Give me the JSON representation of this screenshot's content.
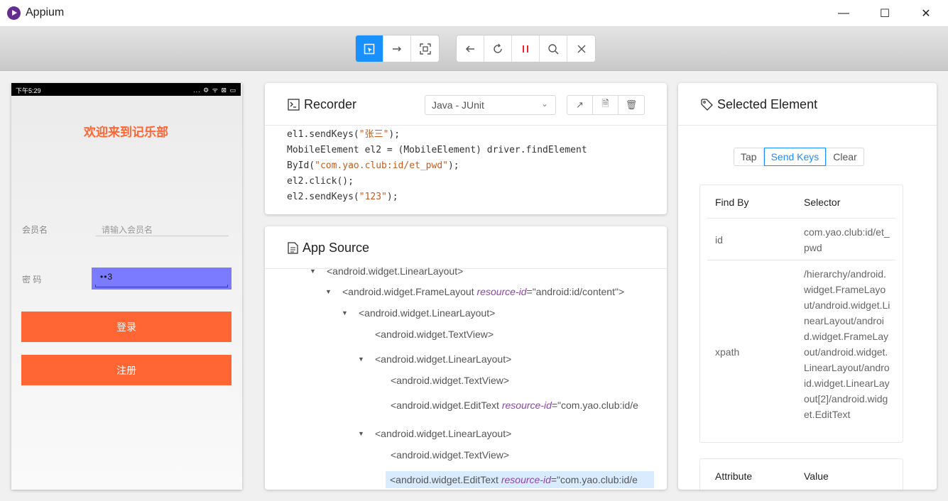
{
  "window": {
    "title": "Appium"
  },
  "toolbar": {
    "pause_icon": "pause-icon"
  },
  "phone": {
    "time": "下午5:29",
    "status_icons": "... ⚙ ᯤ ⊠ ▭",
    "welcome": "欢迎来到记乐部",
    "username_label": "会员名",
    "username_placeholder": "请输入会员名",
    "password_label": "密  码",
    "password_value": "••3",
    "login_button": "登录",
    "register_button": "注册"
  },
  "recorder": {
    "title": "Recorder",
    "language": "Java - JUnit",
    "code_lines": [
      {
        "pre": "el1.sendKeys(",
        "str": "\"张三\"",
        "post": ");"
      },
      {
        "pre": "MobileElement el2 = (MobileElement) driver.findElement",
        "str": "",
        "post": ""
      },
      {
        "pre": "ById(",
        "str": "\"com.yao.club:id/et_pwd\"",
        "post": ");"
      },
      {
        "pre": "el2.click();",
        "str": "",
        "post": ""
      },
      {
        "pre": "el2.sendKeys(",
        "str": "\"123\"",
        "post": ");"
      }
    ]
  },
  "app_source": {
    "title": "App Source",
    "nodes": [
      {
        "tag": "<android.widget.LinearLayout>",
        "attr": "",
        "val": "",
        "expanded": true
      },
      {
        "tag": "<android.widget.FrameLayout ",
        "attr": "resource-id",
        "val": "=\"android:id/content\">",
        "expanded": true
      },
      {
        "tag": "<android.widget.LinearLayout>",
        "attr": "",
        "val": "",
        "expanded": true
      },
      {
        "tag": "<android.widget.TextView>",
        "attr": "",
        "val": "",
        "expanded": false
      },
      {
        "tag": "<android.widget.LinearLayout>",
        "attr": "",
        "val": "",
        "expanded": true
      },
      {
        "tag": "<android.widget.TextView>",
        "attr": "",
        "val": "",
        "expanded": false
      },
      {
        "tag": "<android.widget.EditText ",
        "attr": "resource-id",
        "val": "=\"com.yao.club:id/e",
        "expanded": false
      },
      {
        "tag": "<android.widget.LinearLayout>",
        "attr": "",
        "val": "",
        "expanded": true
      },
      {
        "tag": "<android.widget.TextView>",
        "attr": "",
        "val": "",
        "expanded": false
      },
      {
        "tag": "<android.widget.EditText ",
        "attr": "resource-id",
        "val": "=\"com.yao.club:id/e",
        "expanded": false,
        "selected": true
      }
    ]
  },
  "selected_element": {
    "title": "Selected Element",
    "actions": [
      "Tap",
      "Send Keys",
      "Clear"
    ],
    "find_by_header": "Find By",
    "selector_header": "Selector",
    "rows": [
      {
        "by": "id",
        "selector": "com.yao.club:id/et_pwd"
      },
      {
        "by": "xpath",
        "selector": "/hierarchy/android.widget.FrameLayout/android.widget.LinearLayout/android.widget.FrameLayout/android.widget.LinearLayout/android.widget.LinearLayout[2]/android.widget.EditText"
      }
    ],
    "attribute_header": "Attribute",
    "value_header": "Value"
  }
}
